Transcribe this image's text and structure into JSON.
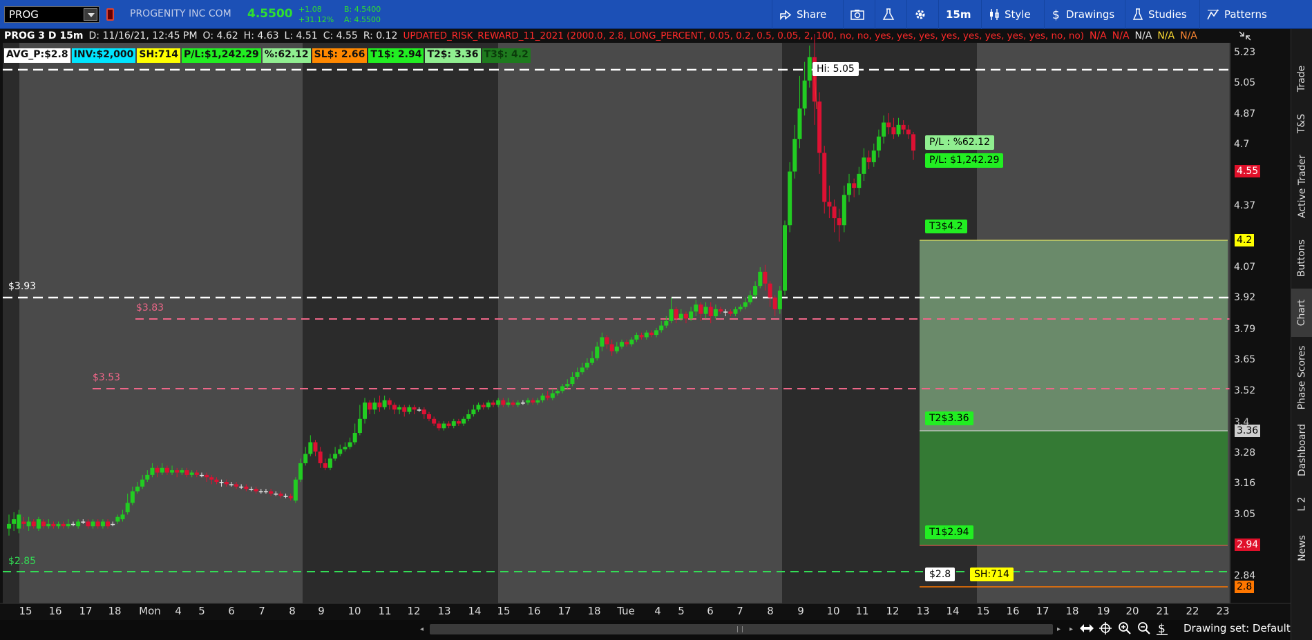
{
  "toolbar": {
    "symbol": "PROG",
    "company": "PROGENITY INC COM",
    "last": "4.5500",
    "change": "+1.08",
    "change_pct": "+31.12%",
    "bid": "B: 4.5400",
    "ask": "A: 4.5500",
    "share": "Share",
    "interval": "15m",
    "style": "Style",
    "drawings": "Drawings",
    "studies": "Studies",
    "patterns": "Patterns"
  },
  "header": {
    "symbol_line": "PROG 3 D 15m",
    "date": "D: 11/16/21, 12:45 PM",
    "open": "O: 4.62",
    "high": "H: 4.63",
    "low": "L: 4.51",
    "close": "C: 4.55",
    "range": "R: 0.12",
    "study": "UPDATED_RISK_REWARD_11_2021 (2000.0, 2.8, LONG_PERCENT, 0.05, 0.2, 0.5, 0.05, 2, 100, no, no, yes, yes, yes, yes, yes, yes, yes, yes, no, no)",
    "na1": "N/A",
    "na2": "N/A",
    "na3": "N/A",
    "na4": "N/A",
    "na5": "N/A"
  },
  "labels": {
    "avg": "AVG_P:$2.8",
    "inv": "INV:$2,000",
    "sh": "SH:714",
    "pl": "P/L:$1,242.29",
    "pct": "%:62.12",
    "sl": "SL$: 2.66",
    "t1": "T1$: 2.94",
    "t2": "T2$: 3.36",
    "t3": "T3$: 4.2"
  },
  "colors": {
    "avg": "#ffffff",
    "inv": "#00e5ff",
    "sh": "#ffff00",
    "pl": "#22ee22",
    "pct": "#90ee90",
    "sl": "#ff8800",
    "t1": "#22ee22",
    "t2": "#90ee90",
    "t3": "#1e7a1e"
  },
  "sidebar": [
    "Trade",
    "T&S",
    "Active Trader",
    "Buttons",
    "Chart",
    "Phase Scores",
    "Dashboard",
    "L 2",
    "News"
  ],
  "bottom": {
    "drawing_set": "Drawing set: Default"
  },
  "chart_data": {
    "type": "candlestick",
    "y_axis_ticks": [
      "5.23",
      "5.05",
      "4.87",
      "4.7",
      "4.55",
      "4.37",
      "4.2",
      "4.07",
      "3.92",
      "3.79",
      "3.65",
      "3.52",
      "3.4",
      "3.28",
      "3.16",
      "3.05",
      "2.94",
      "2.84",
      "2.8"
    ],
    "x_axis_ticks": [
      "15",
      "16",
      "17",
      "18",
      "Mon",
      "4",
      "5",
      "6",
      "7",
      "8",
      "9",
      "10",
      "11",
      "12",
      "13",
      "14",
      "15",
      "16",
      "17",
      "18",
      "Tue",
      "4",
      "5",
      "6",
      "7",
      "8",
      "9",
      "10",
      "11",
      "12",
      "13",
      "14",
      "15",
      "16",
      "17",
      "18",
      "19",
      "20",
      "21",
      "22",
      "23"
    ],
    "hi_label": "Hi: 5.05",
    "price_labels": {
      "last": "4.55",
      "t3": "4.2",
      "t2": "3.36",
      "t1": "2.94",
      "avg": "2.8"
    },
    "lines": {
      "l393": "$3.93",
      "l383": "$3.83",
      "l353": "$3.53",
      "l285": "$2.85"
    },
    "bubbles": {
      "pl_pct": "P/L : %62.12",
      "pl_usd": "P/L:  $1,242.29",
      "t3": "T3$4.2",
      "t2": "T2$3.36",
      "t1": "T1$2.94",
      "avg": "$2.8",
      "sh": "SH:714"
    }
  }
}
